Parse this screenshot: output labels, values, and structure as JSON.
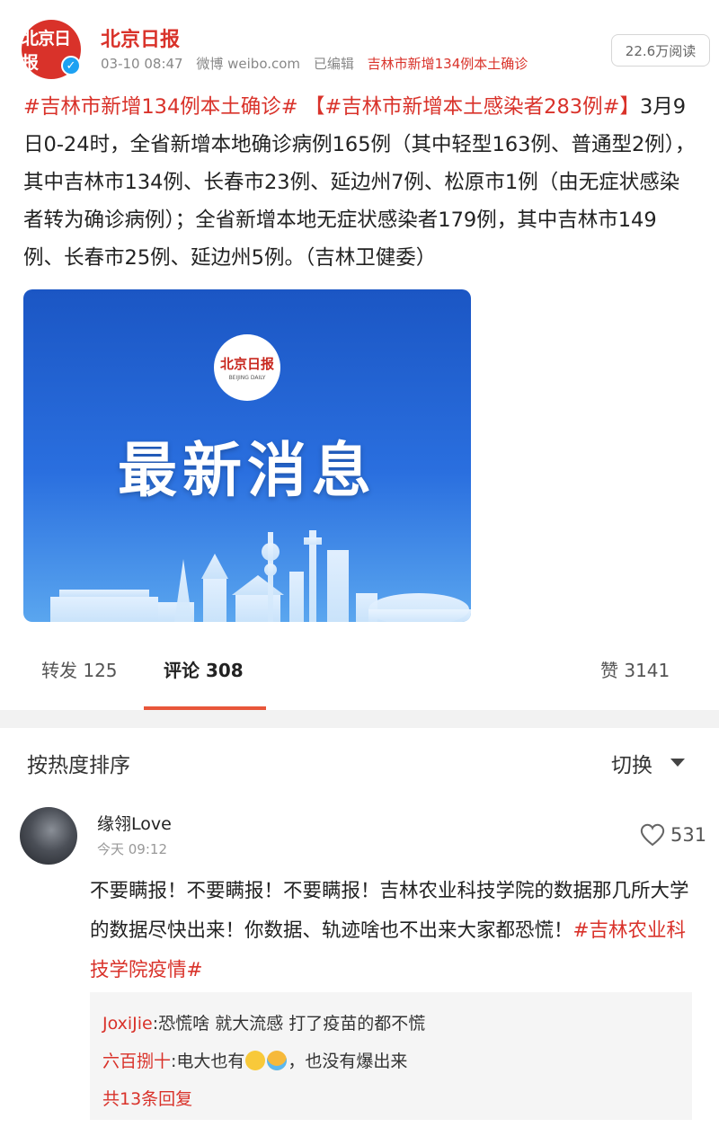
{
  "header": {
    "avatar_text": "北京日报",
    "author": "北京日报",
    "time": "03-10 08:47",
    "source": "微博 weibo.com",
    "edited": "已编辑",
    "topic": "吉林市新增134例本土确诊",
    "read_count": "22.6万阅读"
  },
  "post": {
    "tag1": "#吉林市新增134例本土确诊#",
    "tag2": "【#吉林市新增本土感染者283例#】",
    "body": "3月9日0-24时，全省新增本地确诊病例165例（其中轻型163例、普通型2例），其中吉林市134例、长春市23例、延边州7例、松原市1例（由无症状感染者转为确诊病例）；全省新增本地无症状感染者179例，其中吉林市149例、长春市25例、延边州5例。（吉林卫健委）"
  },
  "image": {
    "logo_text": "北京日报",
    "logo_sub": "BEIJING DAILY",
    "title": "最新消息"
  },
  "tabs": {
    "repost": "转发 125",
    "comment": "评论 308",
    "like": "赞 3141"
  },
  "sort": {
    "label": "按热度排序",
    "switch": "切换"
  },
  "comment": {
    "name": "缘翎Love",
    "time": "今天 09:12",
    "likes": "531",
    "text": "不要瞒报！不要瞒报！不要瞒报！吉林农业科技学院的数据那几所大学的数据尽快出来！你数据、轨迹啥也不出来大家都恐慌！",
    "tag": "#吉林农业科技学院疫情#",
    "replies": [
      {
        "user": "JoxiJie",
        "text": ":恐慌啥 就大流感 打了疫苗的都不慌"
      },
      {
        "user": "六百捌十",
        "text_before": ":电大也有",
        "text_after": "，也没有爆出来"
      }
    ],
    "more_replies": "共13条回复"
  },
  "colors": {
    "accent": "#d9322a",
    "tab_underline": "#e8563a",
    "image_blue": "#1b56c4"
  }
}
